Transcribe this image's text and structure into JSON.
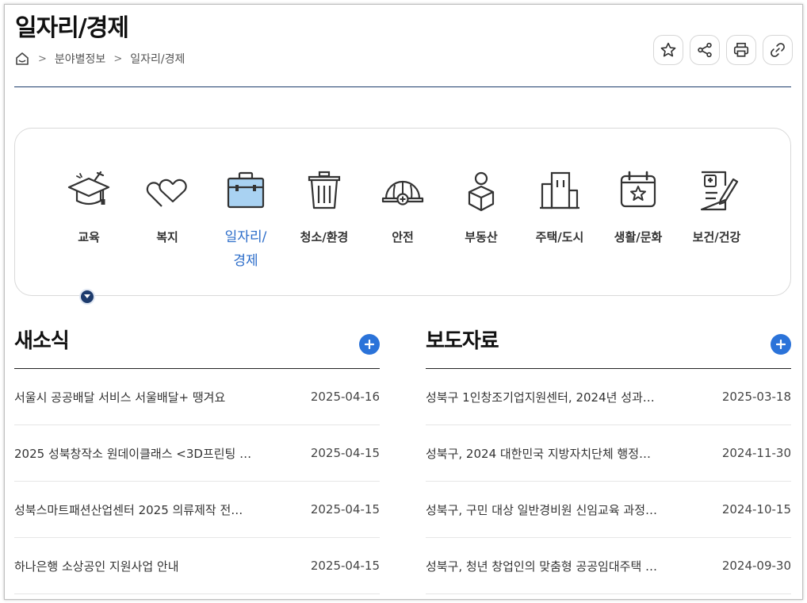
{
  "header": {
    "title": "일자리/경제",
    "breadcrumb": [
      "분야별정보",
      "일자리/경제"
    ]
  },
  "categories": [
    {
      "label": "교육",
      "icon": "graduation-cap-icon",
      "active": false
    },
    {
      "label": "복지",
      "icon": "hearts-icon",
      "active": false
    },
    {
      "label": "일자리/\n경제",
      "icon": "briefcase-icon",
      "active": true
    },
    {
      "label": "청소/환경",
      "icon": "trash-can-icon",
      "active": false
    },
    {
      "label": "안전",
      "icon": "helmet-icon",
      "active": false
    },
    {
      "label": "부동산",
      "icon": "person-box-icon",
      "active": false
    },
    {
      "label": "주택/도시",
      "icon": "buildings-icon",
      "active": false
    },
    {
      "label": "생활/문화",
      "icon": "calendar-star-icon",
      "active": false
    },
    {
      "label": "보건/건강",
      "icon": "medical-document-icon",
      "active": false
    }
  ],
  "news": {
    "title": "새소식",
    "items": [
      {
        "title": "서울시 공공배달 서비스 서울배달+ 땡겨요",
        "date": "2025-04-16"
      },
      {
        "title": "2025 성북창작소 원데이클래스 <3D프린팅 …",
        "date": "2025-04-15"
      },
      {
        "title": "성북스마트패션산업센터 2025 의류제작 전…",
        "date": "2025-04-15"
      },
      {
        "title": "하나은행 소상공인 지원사업 안내",
        "date": "2025-04-15"
      }
    ]
  },
  "press": {
    "title": "보도자료",
    "items": [
      {
        "title": "성북구 1인창조기업지원센터, 2024년 성과…",
        "date": "2025-03-18"
      },
      {
        "title": "성북구, 2024 대한민국 지방자치단체 행정…",
        "date": "2024-11-30"
      },
      {
        "title": "성북구, 구민 대상 일반경비원 신임교육 과정…",
        "date": "2024-10-15"
      },
      {
        "title": "성북구, 청년 창업인의 맞춤형 공공임대주택 …",
        "date": "2024-09-30"
      }
    ]
  },
  "colors": {
    "accent": "#2b73d9",
    "navy": "#1d3b6d",
    "active_text": "#2b6cc9"
  }
}
